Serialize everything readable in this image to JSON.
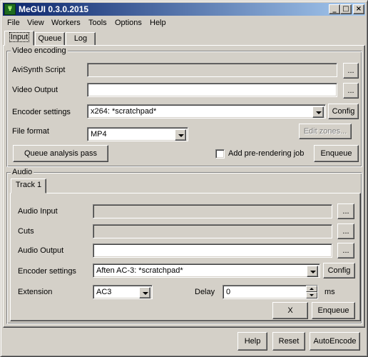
{
  "window": {
    "title": "MeGUI 0.3.0.2015",
    "app_icon_text": "Ψ",
    "minimize_glyph": "_",
    "maximize_glyph": "□",
    "close_glyph": "×"
  },
  "menu": [
    {
      "label": "File"
    },
    {
      "label": "View"
    },
    {
      "label": "Workers"
    },
    {
      "label": "Tools"
    },
    {
      "label": "Options"
    },
    {
      "label": "Help"
    }
  ],
  "tabs": [
    {
      "label": "Input",
      "active": true
    },
    {
      "label": "Queue"
    },
    {
      "label": "Log"
    }
  ],
  "video": {
    "group_label": "Video encoding",
    "avisynth_label": "AviSynth Script",
    "avisynth_value": "",
    "output_label": "Video Output",
    "output_value": "",
    "browse_label": "...",
    "encoder_label": "Encoder settings",
    "encoder_value": "x264: *scratchpad*",
    "config_label": "Config",
    "file_format_label": "File format",
    "file_format_value": "MP4",
    "edit_zones_label": "Edit zones...",
    "queue_analysis_label": "Queue analysis pass",
    "prerender_label": "Add pre-rendering job",
    "prerender_checked": false,
    "enqueue_label": "Enqueue"
  },
  "audio": {
    "group_label": "Audio",
    "track_tab_label": "Track 1",
    "input_label": "Audio Input",
    "input_value": "",
    "cuts_label": "Cuts",
    "cuts_value": "",
    "output_label": "Audio Output",
    "output_value": "",
    "browse_label": "...",
    "encoder_label": "Encoder settings",
    "encoder_value": "Aften AC-3: *scratchpad*",
    "config_label": "Config",
    "extension_label": "Extension",
    "extension_value": "AC3",
    "delay_label": "Delay",
    "delay_value": "0",
    "delay_unit": "ms",
    "x_label": "X",
    "enqueue_label": "Enqueue"
  },
  "footer": {
    "help_label": "Help",
    "reset_label": "Reset",
    "autoencode_label": "AutoEncode"
  }
}
